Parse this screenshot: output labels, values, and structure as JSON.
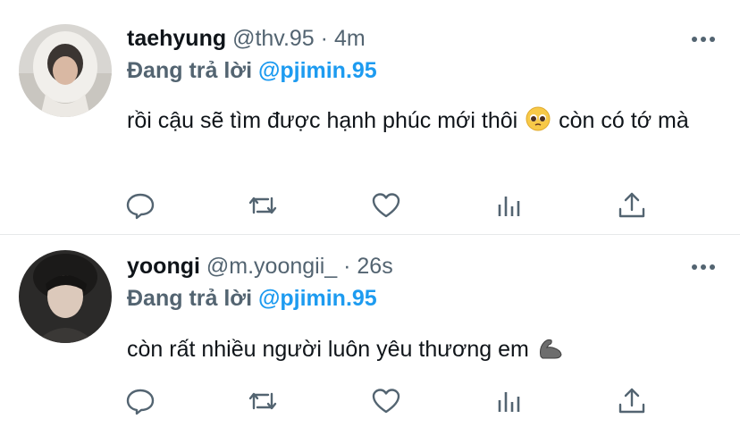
{
  "tweets": [
    {
      "name": "taehyung",
      "handle": "@thv.95",
      "separator": "·",
      "time": "4m",
      "reply_prefix": "Đang trả lời",
      "reply_to": "@pjimin.95",
      "text_before_emoji": "rồi cậu sẽ tìm được hạnh phúc mới thôi",
      "emoji": "pleading-face",
      "text_after_emoji": "còn có tớ mà"
    },
    {
      "name": "yoongi",
      "handle": "@m.yoongii_",
      "separator": "·",
      "time": "26s",
      "reply_prefix": "Đang trả lời",
      "reply_to": "@pjimin.95",
      "text_before_emoji": "còn rất nhiều người luôn yêu thương em",
      "emoji": "flexed-biceps"
    }
  ],
  "icons": {
    "more": "more-dots-icon",
    "reply": "reply-icon",
    "retweet": "retweet-icon",
    "like": "like-icon",
    "analytics": "analytics-icon",
    "share": "share-icon"
  },
  "colors": {
    "text": "#0f1419",
    "secondary": "#536471",
    "mention": "#1d9bf0",
    "divider": "#e7e9ea"
  }
}
